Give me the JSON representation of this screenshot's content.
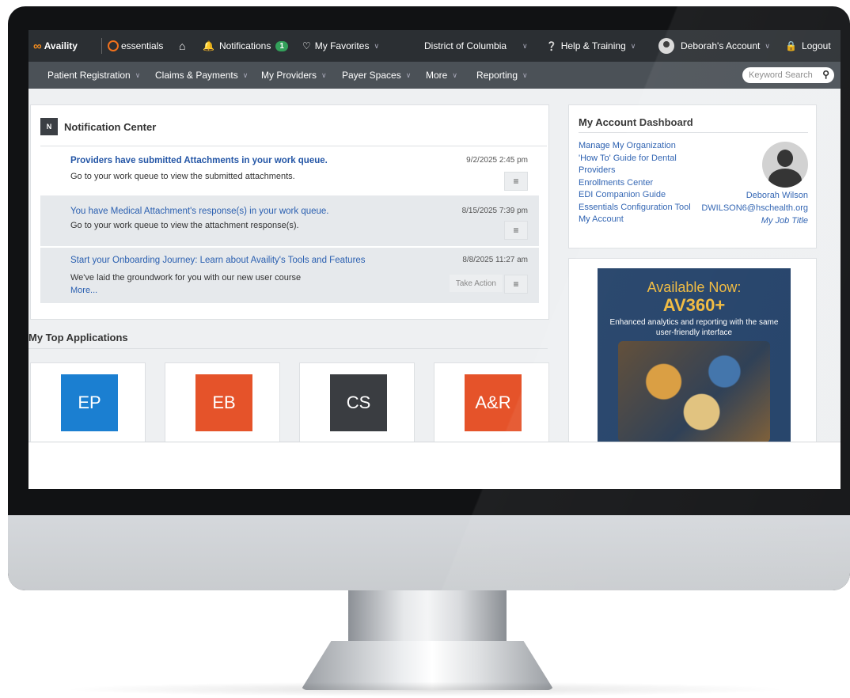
{
  "brand": {
    "availity": "Availity",
    "essentials": "essentials"
  },
  "topnav": {
    "notifications_label": "Notifications",
    "notifications_count": "1",
    "favorites_label": "My Favorites",
    "region_label": "District of Columbia",
    "help_label": "Help & Training",
    "account_label": "Deborah's Account",
    "logout_label": "Logout"
  },
  "subnav": {
    "items": [
      "Patient Registration",
      "Claims & Payments",
      "My Providers",
      "Payer Spaces",
      "More",
      "Reporting"
    ],
    "search_placeholder": "Keyword Search"
  },
  "notification_center": {
    "icon_letter": "N",
    "title": "Notification Center",
    "items": [
      {
        "title": "Providers have submitted Attachments in your work queue.",
        "body": "Go to your work queue to view the submitted attachments.",
        "date": "9/2/2025 2:45 pm"
      },
      {
        "title": "You have Medical Attachment's response(s) in your work queue.",
        "body": "Go to your work queue to view the attachment response(s).",
        "date": "8/15/2025 7:39 pm"
      },
      {
        "title": "Start your Onboarding Journey: Learn about Availity's Tools and Features",
        "body": "We've laid the groundwork for you with our new user course",
        "more": "More...",
        "date": "8/8/2025 11:27 am",
        "action": "Take Action"
      }
    ]
  },
  "top_apps": {
    "title": "My Top Applications",
    "tiles": [
      {
        "label": "EP",
        "color": "#1b7fd1"
      },
      {
        "label": "EB",
        "color": "#e5532a"
      },
      {
        "label": "CS",
        "color": "#3a3d41"
      },
      {
        "label": "A&R",
        "color": "#e5532a"
      }
    ]
  },
  "account_dashboard": {
    "title": "My Account Dashboard",
    "links": [
      "Manage My Organization",
      "'How To' Guide for Dental",
      "Providers",
      "Enrollments Center",
      "EDI Companion Guide",
      "Essentials Configuration Tool",
      "My Account"
    ],
    "user_name": "Deborah Wilson",
    "user_email": "DWILSON6@hschealth.org",
    "job_title": "My Job Title"
  },
  "promo": {
    "line1": "Available Now:",
    "line2": "AV360+",
    "line3": "Enhanced analytics and reporting with the same user-friendly interface"
  }
}
